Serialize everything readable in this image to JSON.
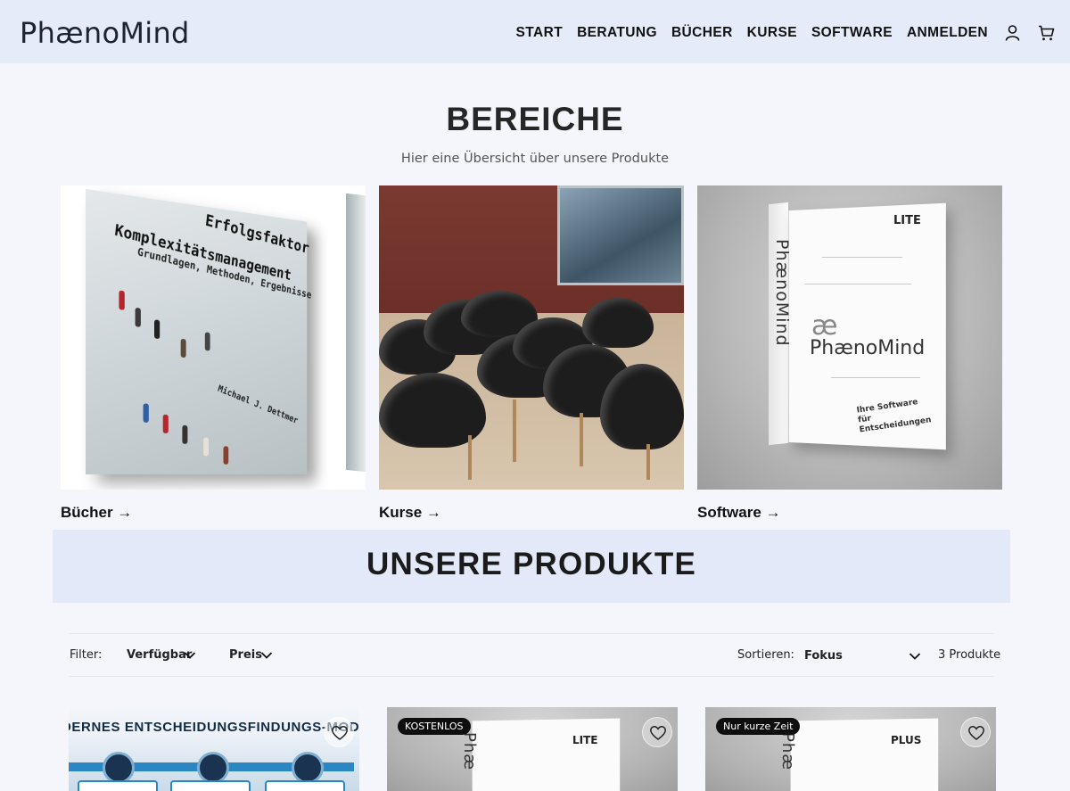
{
  "header": {
    "logo": "PhænoMind",
    "nav": [
      "START",
      "BERATUNG",
      "BÜCHER",
      "KURSE",
      "SOFTWARE",
      "ANMELDEN"
    ]
  },
  "bereiche": {
    "title": "BEREICHE",
    "subtitle": "Hier eine Übersicht über unsere Produkte",
    "cards": [
      {
        "label": "Bücher →",
        "book": {
          "title1": "Erfolgsfaktor",
          "title2": "Komplexitätsmanagement",
          "subtitle": "Grundlagen, Methoden, Ergebnisse",
          "author": "Michael J. Dettmer"
        }
      },
      {
        "label": "Kurse →"
      },
      {
        "label": "Software →",
        "box": {
          "edition": "LITE",
          "logo_mark": "æ",
          "logo": "PhænoMind",
          "vertical": "PhænoMind",
          "tagline": "Ihre Software für Entscheidungen"
        }
      }
    ]
  },
  "produkte": {
    "title": "UNSERE PRODUKTE",
    "filter_label": "Filter:",
    "filters": [
      "Verfügbar",
      "Preis"
    ],
    "sort_label": "Sortieren:",
    "sort_value": "Fokus",
    "count": "3 Produkte",
    "items": [
      {
        "banner": "DERNES ENTSCHEIDUNGSFINDUNGS-MOD"
      },
      {
        "badge": "KOSTENLOS",
        "edition": "LITE",
        "vertical": "Phæ"
      },
      {
        "badge": "Nur kurze Zeit",
        "edition": "PLUS",
        "vertical": "Phæ"
      }
    ]
  },
  "colors": {
    "header_bg": "#e6ebf9",
    "page_bg": "#f4f6fc",
    "band_bg": "#e4e9f9",
    "accent_blue": "#2b86c4"
  }
}
